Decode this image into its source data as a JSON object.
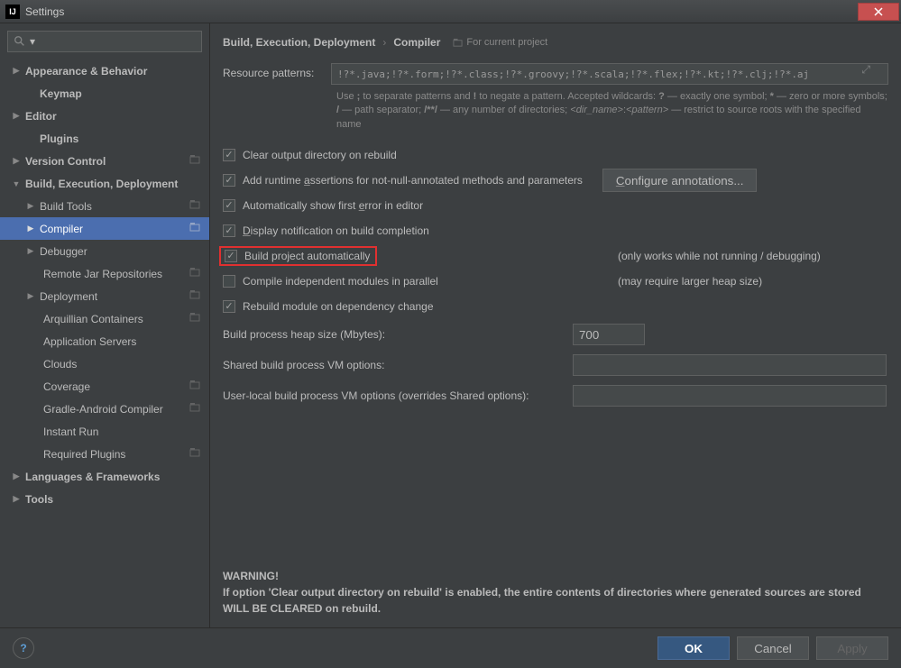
{
  "window": {
    "title": "Settings"
  },
  "breadcrumb": {
    "root": "Build, Execution, Deployment",
    "leaf": "Compiler",
    "scope": "For current project"
  },
  "sidebar": {
    "items": [
      {
        "label": "Appearance & Behavior"
      },
      {
        "label": "Keymap"
      },
      {
        "label": "Editor"
      },
      {
        "label": "Plugins"
      },
      {
        "label": "Version Control"
      },
      {
        "label": "Build, Execution, Deployment"
      },
      {
        "label": "Build Tools"
      },
      {
        "label": "Compiler"
      },
      {
        "label": "Debugger"
      },
      {
        "label": "Remote Jar Repositories"
      },
      {
        "label": "Deployment"
      },
      {
        "label": "Arquillian Containers"
      },
      {
        "label": "Application Servers"
      },
      {
        "label": "Clouds"
      },
      {
        "label": "Coverage"
      },
      {
        "label": "Gradle-Android Compiler"
      },
      {
        "label": "Instant Run"
      },
      {
        "label": "Required Plugins"
      },
      {
        "label": "Languages & Frameworks"
      },
      {
        "label": "Tools"
      }
    ]
  },
  "compiler": {
    "resource_patterns_label": "Resource patterns:",
    "resource_patterns": "!?*.java;!?*.form;!?*.class;!?*.groovy;!?*.scala;!?*.flex;!?*.kt;!?*.clj;!?*.aj",
    "resource_hint": "Use ; to separate patterns and ! to negate a pattern. Accepted wildcards: ? — exactly one symbol; * — zero or more symbols; / — path separator; /**/ — any number of directories; <dir_name>:<pattern> — restrict to source roots with the specified name",
    "clear_output": "Clear output directory on rebuild",
    "add_runtime": "Add runtime assertions for not-null-annotated methods and parameters",
    "configure_btn": "Configure annotations...",
    "auto_error": "Automatically show first error in editor",
    "notify_build": "Display notification on build completion",
    "build_auto": "Build project automatically",
    "build_auto_note": "(only works while not running / debugging)",
    "compile_parallel": "Compile independent modules in parallel",
    "compile_parallel_note": "(may require larger heap size)",
    "rebuild_dep": "Rebuild module on dependency change",
    "heap_label": "Build process heap size (Mbytes):",
    "heap_value": "700",
    "shared_vm_label": "Shared build process VM options:",
    "shared_vm_value": "",
    "user_vm_label": "User-local build process VM options (overrides Shared options):",
    "user_vm_value": "",
    "warning_title": "WARNING!",
    "warning_body": "If option 'Clear output directory on rebuild' is enabled, the entire contents of directories where generated sources are stored WILL BE CLEARED on rebuild."
  },
  "footer": {
    "ok": "OK",
    "cancel": "Cancel",
    "apply": "Apply"
  }
}
